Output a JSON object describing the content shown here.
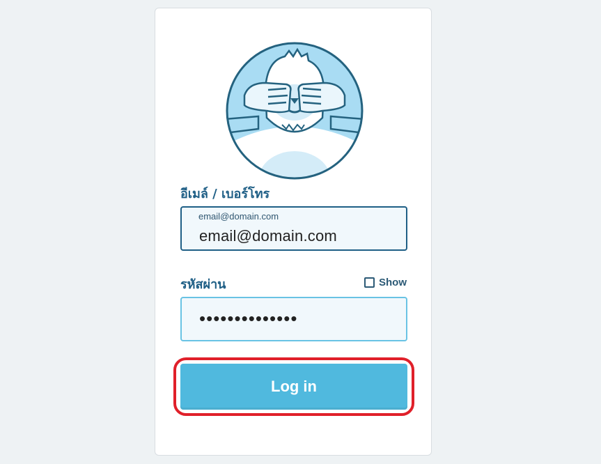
{
  "form": {
    "email_label": "อีเมล์ / เบอร์โทร",
    "email_floating_label": "email@domain.com",
    "email_value": "email@domain.com",
    "password_label": "รหัสผ่าน",
    "password_value": "••••••••••••••",
    "show_label": "Show",
    "show_checked": false,
    "login_label": "Log in"
  },
  "avatar": {
    "icon": "yeti-covering-eyes-icon"
  },
  "colors": {
    "label": "#1f5f86",
    "button": "#50b9de",
    "highlight": "#e0202a",
    "field_bg": "#f1f8fc"
  }
}
